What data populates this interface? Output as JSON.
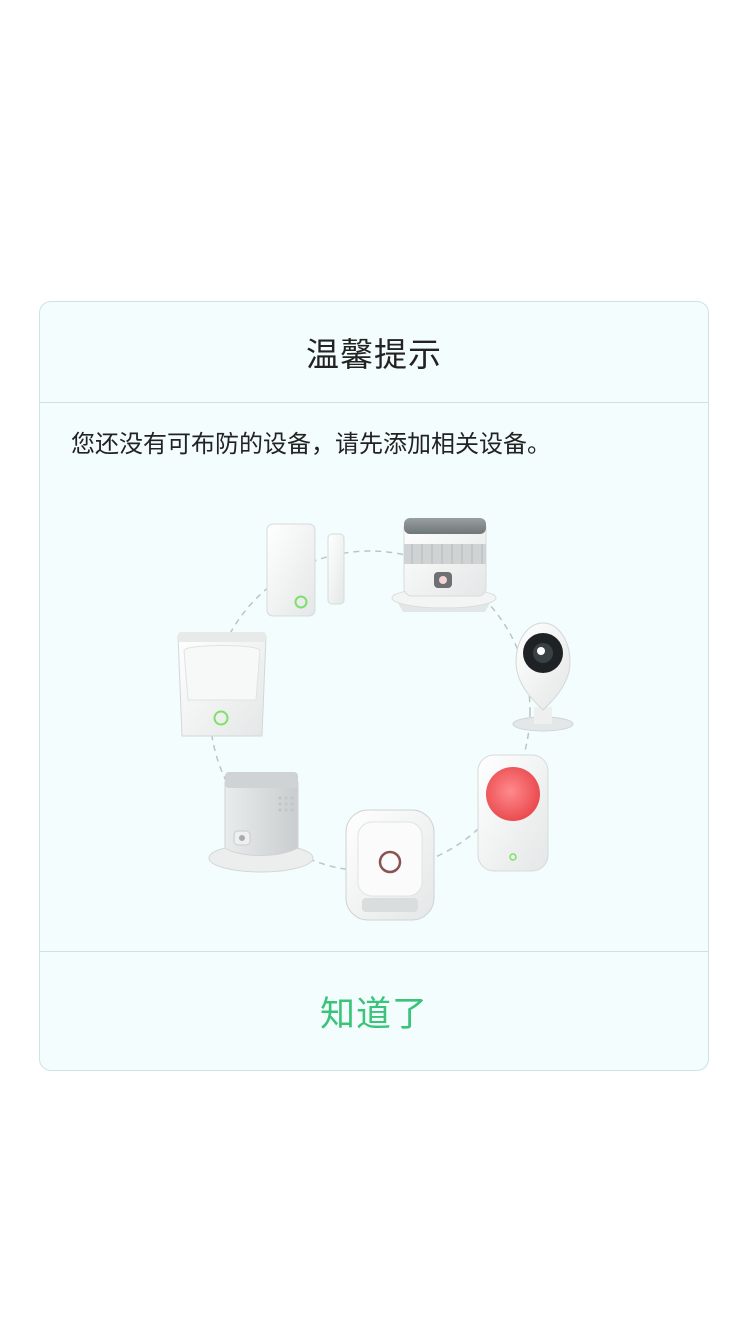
{
  "dialog": {
    "title": "温馨提示",
    "message": "您还没有可布防的设备，请先添加相关设备。",
    "confirm_label": "知道了"
  },
  "illustration": {
    "devices": [
      "door-sensor-icon",
      "smoke-detector-icon",
      "security-camera-icon",
      "emergency-button-icon",
      "gas-detector-icon",
      "air-quality-sensor-icon",
      "motion-sensor-icon"
    ],
    "colors": {
      "led_green": "#7ee06a",
      "alarm_red": "#f05a5e",
      "device_white": "#f7f7f7",
      "device_shade": "#d9dcdc",
      "circle_dash": "#b9c6c6"
    }
  },
  "theme": {
    "accent": "#3ac47a",
    "dialog_bg": "#f4fdfd",
    "divider": "#cfe0e0"
  }
}
